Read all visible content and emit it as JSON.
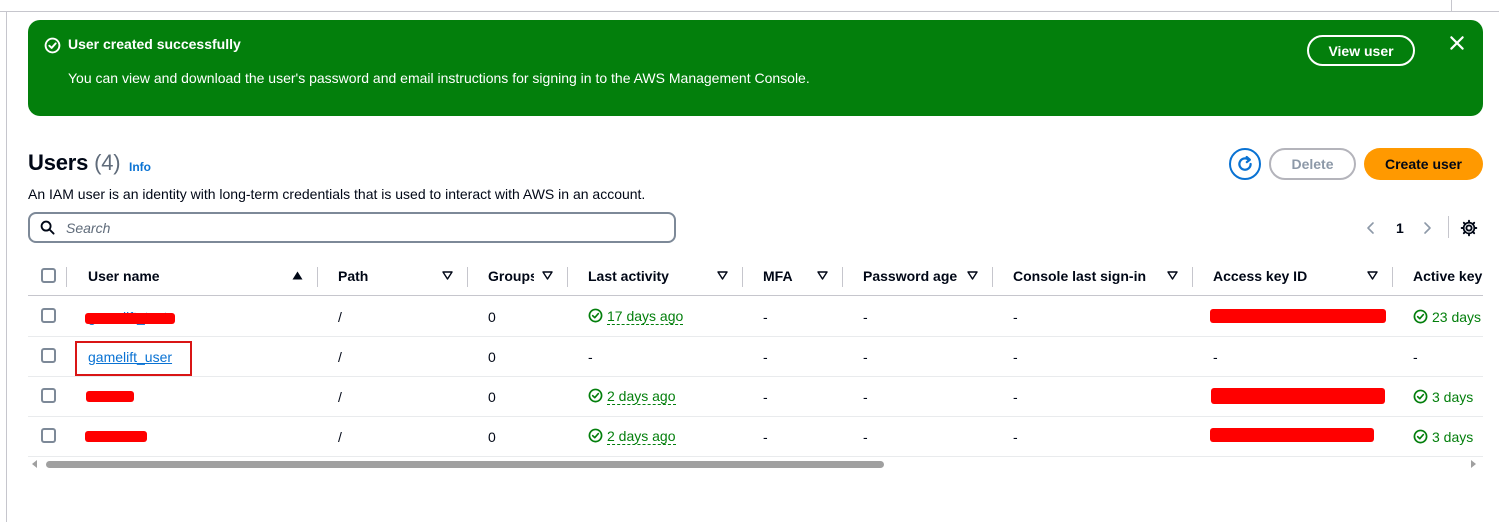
{
  "flash": {
    "title": "User created successfully",
    "message": "You can view and download the user's password and email instructions for signing in to the AWS Management Console.",
    "view_button": "View user",
    "bg_color": "#037f0c"
  },
  "header": {
    "title": "Users",
    "count": "(4)",
    "info": "Info",
    "description": "An IAM user is an identity with long-term credentials that is used to interact with AWS in an account.",
    "delete_label": "Delete",
    "create_label": "Create user"
  },
  "search": {
    "placeholder": "Search"
  },
  "pagination": {
    "current_page": "1"
  },
  "table": {
    "columns": [
      "User name",
      "Path",
      "Groups",
      "Last activity",
      "MFA",
      "Password age",
      "Console last sign-in",
      "Access key ID",
      "Active key"
    ],
    "rows": [
      {
        "user_name": "gamelift_test",
        "path": "/",
        "groups": "0",
        "last_activity": "17 days ago",
        "mfa": "-",
        "password_age": "-",
        "console_last_signin": "-",
        "access_key_id": "",
        "active_key": "23 days"
      },
      {
        "user_name": "gamelift_user",
        "path": "/",
        "groups": "0",
        "last_activity": "-",
        "mfa": "-",
        "password_age": "-",
        "console_last_signin": "-",
        "access_key_id": "-",
        "active_key": "-"
      },
      {
        "user_name": "",
        "path": "/",
        "groups": "0",
        "last_activity": "2 days ago",
        "mfa": "-",
        "password_age": "-",
        "console_last_signin": "-",
        "access_key_id": "",
        "active_key": "3 days"
      },
      {
        "user_name": "",
        "path": "/",
        "groups": "0",
        "last_activity": "2 days ago",
        "mfa": "-",
        "password_age": "-",
        "console_last_signin": "-",
        "access_key_id": "",
        "active_key": "3 days"
      }
    ]
  },
  "colors": {
    "link": "#0972d3",
    "success": "#037f0c",
    "primary_button": "#ff9900",
    "redaction": "#ff0000"
  }
}
